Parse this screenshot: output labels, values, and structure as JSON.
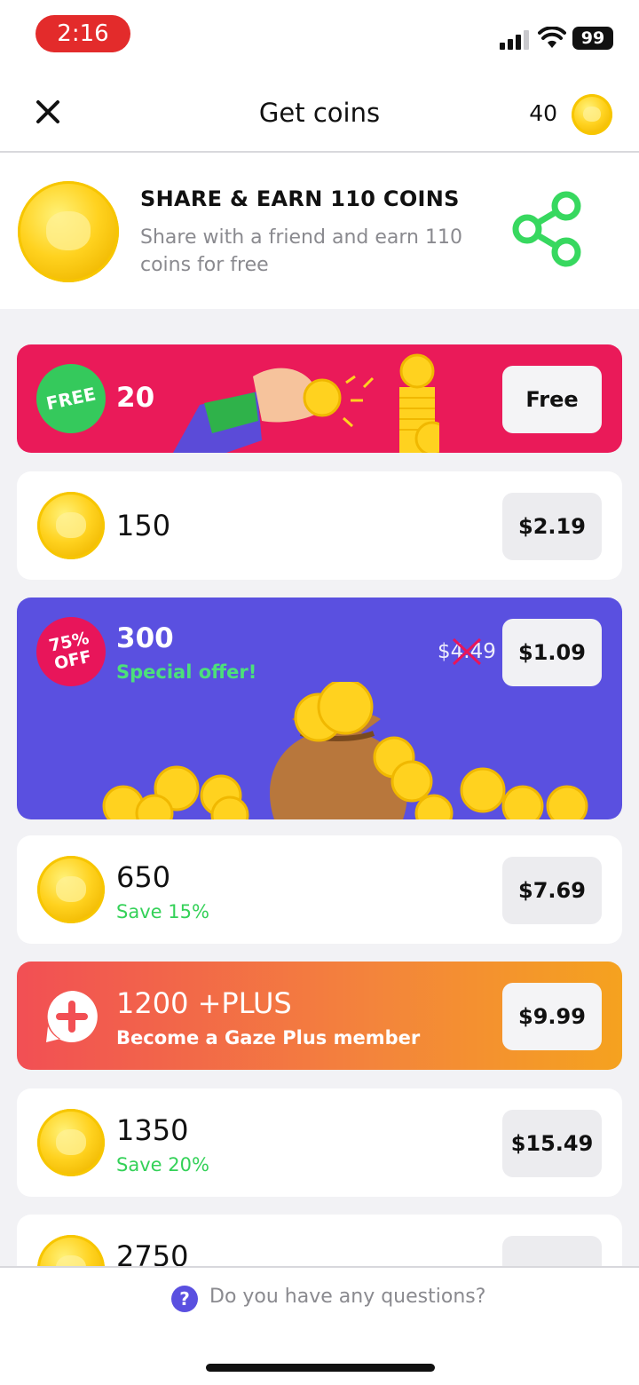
{
  "status_bar": {
    "time": "2:16",
    "battery": "99"
  },
  "header": {
    "title": "Get coins",
    "balance": "40"
  },
  "share": {
    "title": "SHARE & EARN 110 COINS",
    "subtitle": "Share with a friend and earn 110 coins for free"
  },
  "packages": [
    {
      "badge": "FREE",
      "amount": "20",
      "price": "Free"
    },
    {
      "amount": "150",
      "price": "$2.19"
    },
    {
      "badge": "75% OFF",
      "amount": "300",
      "label": "Special offer!",
      "old_price": "$4.49",
      "price": "$1.09"
    },
    {
      "amount": "650",
      "label": "Save 15%",
      "price": "$7.69"
    },
    {
      "amount": "1200 +PLUS",
      "label": "Become a Gaze Plus member",
      "price": "$9.99"
    },
    {
      "amount": "1350",
      "label": "Save 20%",
      "price": "$15.49"
    },
    {
      "amount": "2750"
    }
  ],
  "footer": {
    "help_text": "Do you have any questions?",
    "help_icon": "?"
  },
  "colors": {
    "accent": "#5a50e0",
    "free": "#ea1a59",
    "save_green": "#34d158",
    "coin": "#ffd21f"
  }
}
